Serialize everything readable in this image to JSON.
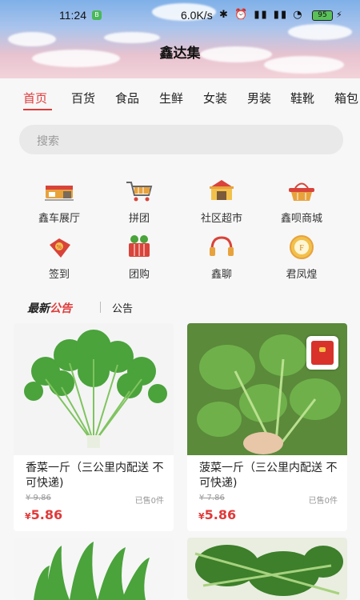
{
  "status_bar": {
    "time": "11:24",
    "badge": "B",
    "net_speed": "6.0K/s",
    "icons": "✱ ⏰ ▮▮ ▮▮ ◔",
    "battery": "95"
  },
  "app_title": "鑫达集",
  "tabs": [
    {
      "label": "首页",
      "active": true
    },
    {
      "label": "百货"
    },
    {
      "label": "食品"
    },
    {
      "label": "生鲜"
    },
    {
      "label": "女装"
    },
    {
      "label": "男装"
    },
    {
      "label": "鞋靴"
    },
    {
      "label": "箱包"
    }
  ],
  "search": {
    "placeholder": "搜索"
  },
  "quick_links": [
    {
      "label": "鑫车展厅",
      "icon": "car-showroom-icon"
    },
    {
      "label": "拼团",
      "icon": "shopping-cart-icon"
    },
    {
      "label": "社区超市",
      "icon": "supermarket-icon"
    },
    {
      "label": "鑫呗商城",
      "icon": "shopping-basket-icon"
    },
    {
      "label": "签到",
      "icon": "coupon-icon"
    },
    {
      "label": "团购",
      "icon": "group-buy-basket-icon"
    },
    {
      "label": "鑫聊",
      "icon": "headset-icon"
    },
    {
      "label": "君凤煌",
      "icon": "coin-icon"
    }
  ],
  "notice": {
    "brand_a": "最新",
    "brand_b": "公告",
    "text": "公告"
  },
  "products": [
    {
      "name": "香菜一斤（三公里内配送 不可快递)",
      "old_price": "¥ 9.86",
      "sold": "已售0件",
      "currency": "¥",
      "price": "5.86"
    },
    {
      "name": "菠菜一斤（三公里内配送 不可快递)",
      "old_price": "¥ 7.86",
      "sold": "已售0件",
      "currency": "¥",
      "price": "5.86"
    }
  ],
  "colors": {
    "accent": "#e03a3a",
    "vegetable_green": "#3f9a2e"
  }
}
